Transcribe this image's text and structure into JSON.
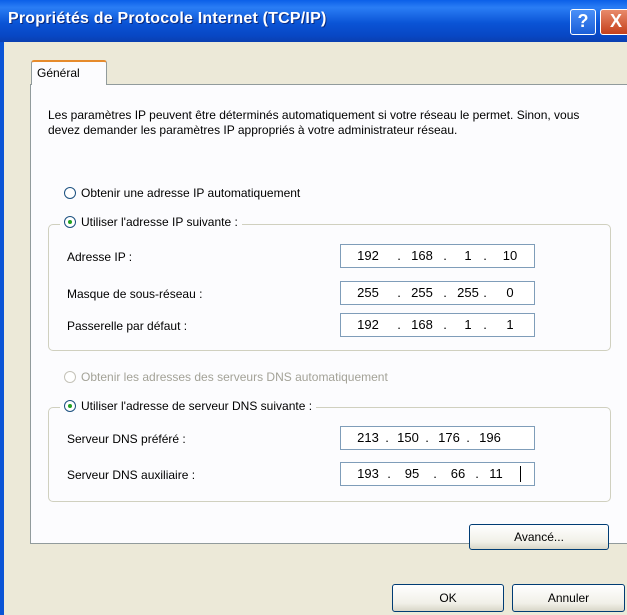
{
  "window": {
    "title": "Propriétés de Protocole Internet (TCP/IP)",
    "help_glyph": "?",
    "close_glyph": "X"
  },
  "tabs": [
    {
      "label": "Général",
      "selected": true
    }
  ],
  "description": "Les paramètres IP peuvent être déterminés automatiquement si votre réseau le permet. Sinon, vous devez demander les paramètres IP appropriés à votre administrateur réseau.",
  "ip_mode": {
    "auto_label": "Obtenir une adresse IP automatiquement",
    "manual_label": "Utiliser l'adresse IP suivante :",
    "selected": "manual"
  },
  "ip_fields": [
    {
      "label": "Adresse IP :",
      "octets": [
        "192",
        "168",
        "1",
        "10"
      ]
    },
    {
      "label": "Masque de sous-réseau :",
      "octets": [
        "255",
        "255",
        "255",
        "0"
      ]
    },
    {
      "label": "Passerelle par défaut :",
      "octets": [
        "192",
        "168",
        "1",
        "1"
      ]
    }
  ],
  "dns_mode": {
    "auto_label": "Obtenir les adresses des serveurs DNS automatiquement",
    "auto_enabled": false,
    "manual_label": "Utiliser l'adresse de serveur DNS suivante :",
    "selected": "manual"
  },
  "dns_fields": [
    {
      "label": "Serveur DNS préféré :",
      "octets": [
        "213",
        "150",
        "176",
        "196"
      ]
    },
    {
      "label": "Serveur DNS auxiliaire :",
      "octets": [
        "193",
        "95",
        "66",
        "11"
      ]
    }
  ],
  "buttons": {
    "advanced": "Avancé...",
    "ok": "OK",
    "cancel": "Annuler"
  },
  "colors": {
    "title_bar": "#0a54d6",
    "dialog_face": "#ece9d8",
    "radio_dot": "#21a121",
    "tab_highlight": "#e68b2c"
  }
}
